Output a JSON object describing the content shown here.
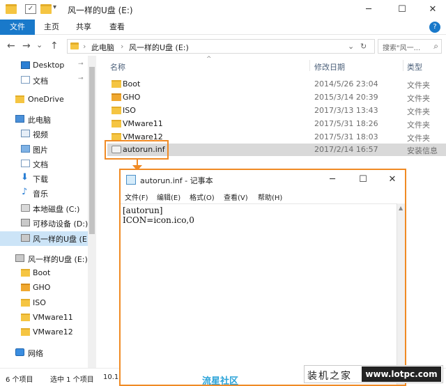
{
  "window": {
    "title": "风一样的U盘 (E:)",
    "minimize": "─",
    "maximize": "☐",
    "close": "✕"
  },
  "ribbon": {
    "tabs": [
      "文件",
      "主页",
      "共享",
      "查看"
    ],
    "help": "?"
  },
  "address": {
    "back": "←",
    "forward": "→",
    "recent": "⌄",
    "up": "↑",
    "crumbs": [
      "此电脑",
      "风一样的U盘 (E:)"
    ],
    "separator": "›",
    "dropdown": "⌄",
    "refresh": "↻",
    "search_placeholder": "搜索\"风一...",
    "search_icon": "⌕"
  },
  "nav": {
    "items": [
      {
        "label": "Desktop",
        "icon": "desktop-icon",
        "pinned": true
      },
      {
        "label": "文档",
        "icon": "document-icon",
        "pinned": true
      },
      {
        "label": "OneDrive",
        "icon": "onedrive-icon"
      },
      {
        "label": "此电脑",
        "icon": "computer-icon"
      },
      {
        "label": "视频",
        "icon": "video-icon"
      },
      {
        "label": "图片",
        "icon": "picture-icon"
      },
      {
        "label": "文档",
        "icon": "document-icon"
      },
      {
        "label": "下载",
        "icon": "download-icon"
      },
      {
        "label": "音乐",
        "icon": "music-icon"
      },
      {
        "label": "本地磁盘 (C:)",
        "icon": "drive-icon"
      },
      {
        "label": "可移动设备 (D:)",
        "icon": "usb-icon"
      },
      {
        "label": "风一样的U盘 (E:",
        "icon": "usb-icon",
        "selected": true
      },
      {
        "label": "风一样的U盘 (E:)",
        "icon": "usb-icon"
      },
      {
        "label": "Boot",
        "icon": "folder-icon"
      },
      {
        "label": "GHO",
        "icon": "folder-icon"
      },
      {
        "label": "ISO",
        "icon": "folder-icon"
      },
      {
        "label": "VMware11",
        "icon": "folder-icon"
      },
      {
        "label": "VMware12",
        "icon": "folder-icon"
      },
      {
        "label": "网络",
        "icon": "network-icon"
      }
    ],
    "pin_glyph": "⊸",
    "download_glyph": "⬇",
    "music_glyph": "♪"
  },
  "files": {
    "columns": {
      "name": "名称",
      "date": "修改日期",
      "type": "类型",
      "sort": "^"
    },
    "rows": [
      {
        "name": "Boot",
        "date": "2014/5/26 23:04",
        "type": "文件夹"
      },
      {
        "name": "GHO",
        "date": "2015/3/14 20:39",
        "type": "文件夹"
      },
      {
        "name": "ISO",
        "date": "2017/3/13 13:43",
        "type": "文件夹"
      },
      {
        "name": "VMware11",
        "date": "2017/5/31 18:26",
        "type": "文件夹"
      },
      {
        "name": "VMware12",
        "date": "2017/5/31 18:03",
        "type": "文件夹"
      },
      {
        "name": "autorun.inf",
        "date": "2017/2/14 16:57",
        "type": "安装信息",
        "selected": true
      }
    ]
  },
  "status": {
    "count": "6 个项目",
    "selected": "选中 1 个项目",
    "size": "10.1"
  },
  "notepad": {
    "title": "autorun.inf - 记事本",
    "minimize": "─",
    "maximize": "☐",
    "close": "✕",
    "menu": [
      "文件(F)",
      "编辑(E)",
      "格式(O)",
      "查看(V)",
      "帮助(H)"
    ],
    "lines": [
      "[autorun]",
      "ICON=icon.ico,0"
    ],
    "scroll_up": "▲"
  },
  "watermark": {
    "left": "流星社区",
    "site_name": "装机之家",
    "url": "www.lotpc.com"
  },
  "colors": {
    "accent": "#1979ca",
    "highlight": "#f08a24",
    "selection": "#cce4f7"
  }
}
